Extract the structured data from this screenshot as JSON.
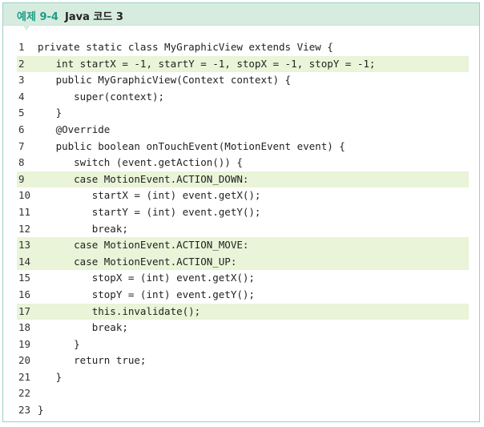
{
  "header": {
    "label": "예제 9-4",
    "title": "Java 코드 3"
  },
  "code_lines": [
    {
      "num": "1",
      "text": "private static class MyGraphicView extends View {",
      "highlight": false
    },
    {
      "num": "2",
      "text": "   int startX = -1, startY = -1, stopX = -1, stopY = -1;",
      "highlight": true
    },
    {
      "num": "3",
      "text": "   public MyGraphicView(Context context) {",
      "highlight": false
    },
    {
      "num": "4",
      "text": "      super(context);",
      "highlight": false
    },
    {
      "num": "5",
      "text": "   }",
      "highlight": false
    },
    {
      "num": "6",
      "text": "   @Override",
      "highlight": false
    },
    {
      "num": "7",
      "text": "   public boolean onTouchEvent(MotionEvent event) {",
      "highlight": false
    },
    {
      "num": "8",
      "text": "      switch (event.getAction()) {",
      "highlight": false
    },
    {
      "num": "9",
      "text": "      case MotionEvent.ACTION_DOWN:",
      "highlight": true
    },
    {
      "num": "10",
      "text": "         startX = (int) event.getX();",
      "highlight": false
    },
    {
      "num": "11",
      "text": "         startY = (int) event.getY();",
      "highlight": false
    },
    {
      "num": "12",
      "text": "         break;",
      "highlight": false
    },
    {
      "num": "13",
      "text": "      case MotionEvent.ACTION_MOVE:",
      "highlight": true
    },
    {
      "num": "14",
      "text": "      case MotionEvent.ACTION_UP:",
      "highlight": true
    },
    {
      "num": "15",
      "text": "         stopX = (int) event.getX();",
      "highlight": false
    },
    {
      "num": "16",
      "text": "         stopY = (int) event.getY();",
      "highlight": false
    },
    {
      "num": "17",
      "text": "         this.invalidate();",
      "highlight": true
    },
    {
      "num": "18",
      "text": "         break;",
      "highlight": false
    },
    {
      "num": "19",
      "text": "      }",
      "highlight": false
    },
    {
      "num": "20",
      "text": "      return true;",
      "highlight": false
    },
    {
      "num": "21",
      "text": "   }",
      "highlight": false
    },
    {
      "num": "22",
      "text": "",
      "highlight": false
    },
    {
      "num": "23",
      "text": "}",
      "highlight": false
    }
  ],
  "colors": {
    "header_bg": "#d6ecdf",
    "label_color": "#1f9e86",
    "highlight_bg": "#e9f4d8",
    "border": "#9ccfc4"
  }
}
